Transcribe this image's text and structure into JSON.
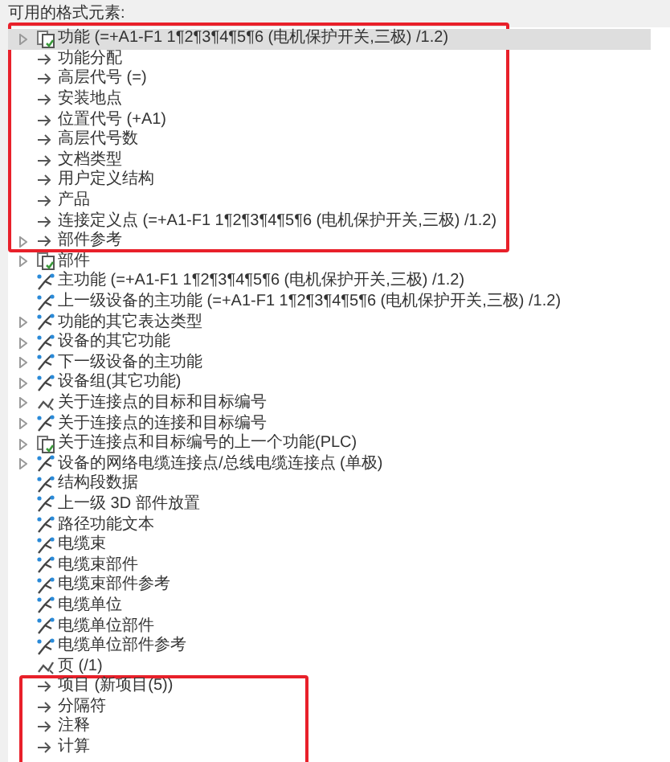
{
  "header": {
    "label": "可用的格式元素:"
  },
  "tree": {
    "items": [
      {
        "label": "功能 (=+A1-F1 1¶2¶3¶4¶5¶6 (电机保护开关,三极) /1.2)",
        "kind": "document",
        "expandable": true,
        "selected": true
      },
      {
        "label": "功能分配",
        "kind": "arrow",
        "expandable": false,
        "selected": false
      },
      {
        "label": "高层代号 (=)",
        "kind": "arrow",
        "expandable": false,
        "selected": false
      },
      {
        "label": "安装地点",
        "kind": "arrow",
        "expandable": false,
        "selected": false
      },
      {
        "label": "位置代号 (+A1)",
        "kind": "arrow",
        "expandable": false,
        "selected": false
      },
      {
        "label": "高层代号数",
        "kind": "arrow",
        "expandable": false,
        "selected": false
      },
      {
        "label": "文档类型",
        "kind": "arrow",
        "expandable": false,
        "selected": false
      },
      {
        "label": "用户定义结构",
        "kind": "arrow",
        "expandable": false,
        "selected": false
      },
      {
        "label": "产品",
        "kind": "arrow",
        "expandable": false,
        "selected": false
      },
      {
        "label": "连接定义点 (=+A1-F1 1¶2¶3¶4¶5¶6 (电机保护开关,三极) /1.2)",
        "kind": "arrow",
        "expandable": false,
        "selected": false
      },
      {
        "label": "部件参考",
        "kind": "arrow",
        "expandable": true,
        "selected": false
      },
      {
        "label": "部件",
        "kind": "document",
        "expandable": true,
        "selected": false
      },
      {
        "label": "主功能 (=+A1-F1 1¶2¶3¶4¶5¶6 (电机保护开关,三极) /1.2)",
        "kind": "function",
        "expandable": false,
        "selected": false
      },
      {
        "label": "上一级设备的主功能 (=+A1-F1 1¶2¶3¶4¶5¶6 (电机保护开关,三极) /1.2)",
        "kind": "function",
        "expandable": false,
        "selected": false
      },
      {
        "label": "功能的其它表达类型",
        "kind": "function",
        "expandable": true,
        "selected": false
      },
      {
        "label": "设备的其它功能",
        "kind": "function",
        "expandable": true,
        "selected": false
      },
      {
        "label": "下一级设备的主功能",
        "kind": "function",
        "expandable": true,
        "selected": false
      },
      {
        "label": "设备组(其它功能)",
        "kind": "function",
        "expandable": true,
        "selected": false
      },
      {
        "label": "关于连接点的目标和目标编号",
        "kind": "connection",
        "expandable": true,
        "selected": false
      },
      {
        "label": "关于连接点的连接和目标编号",
        "kind": "function",
        "expandable": true,
        "selected": false
      },
      {
        "label": "关于连接点和目标编号的上一个功能(PLC)",
        "kind": "document",
        "expandable": true,
        "selected": false
      },
      {
        "label": "设备的网络电缆连接点/总线电缆连接点 (单极)",
        "kind": "function",
        "expandable": true,
        "selected": false
      },
      {
        "label": "结构段数据",
        "kind": "function",
        "expandable": false,
        "selected": false
      },
      {
        "label": "上一级 3D 部件放置",
        "kind": "function",
        "expandable": false,
        "selected": false
      },
      {
        "label": "路径功能文本",
        "kind": "function",
        "expandable": false,
        "selected": false
      },
      {
        "label": "电缆束",
        "kind": "function",
        "expandable": false,
        "selected": false
      },
      {
        "label": "电缆束部件",
        "kind": "function",
        "expandable": false,
        "selected": false
      },
      {
        "label": "电缆束部件参考",
        "kind": "function",
        "expandable": false,
        "selected": false
      },
      {
        "label": "电缆单位",
        "kind": "function",
        "expandable": false,
        "selected": false
      },
      {
        "label": "电缆单位部件",
        "kind": "function",
        "expandable": false,
        "selected": false
      },
      {
        "label": "电缆单位部件参考",
        "kind": "function",
        "expandable": false,
        "selected": false
      },
      {
        "label": "页 (/1)",
        "kind": "connection",
        "expandable": false,
        "selected": false
      },
      {
        "label": "项目 (新项目(5))",
        "kind": "arrow",
        "expandable": false,
        "selected": false
      },
      {
        "label": "分隔符",
        "kind": "arrow",
        "expandable": false,
        "selected": false
      },
      {
        "label": "注释",
        "kind": "arrow",
        "expandable": false,
        "selected": false
      },
      {
        "label": "计算",
        "kind": "arrow",
        "expandable": false,
        "selected": false
      }
    ]
  }
}
